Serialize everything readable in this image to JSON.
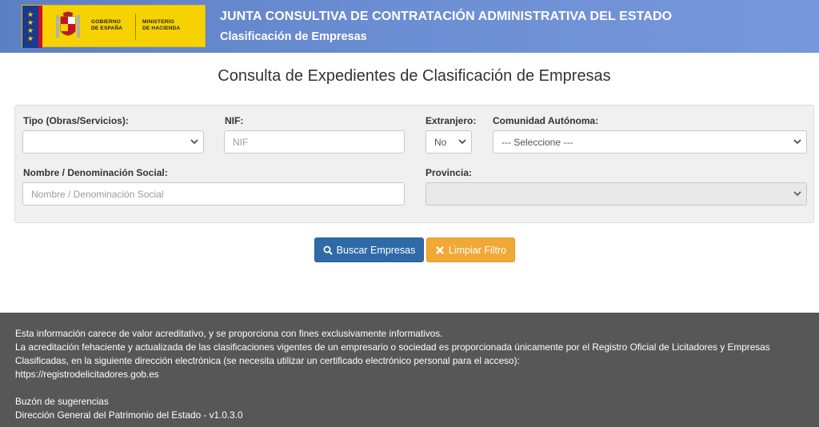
{
  "header": {
    "logo": {
      "gobierno_line1": "GOBIERNO",
      "gobierno_line2": "DE ESPAÑA",
      "ministerio_line1": "MINISTERIO",
      "ministerio_line2": "DE HACIENDA"
    },
    "title": "JUNTA CONSULTIVA DE CONTRATACIÓN ADMINISTRATIVA DEL ESTADO",
    "subtitle": "Clasificación de Empresas"
  },
  "page_title": "Consulta de Expedientes de Clasificación de Empresas",
  "form": {
    "tipo": {
      "label": "Tipo (Obras/Servicios):",
      "value": ""
    },
    "nif": {
      "label": "NIF:",
      "placeholder": "NIF"
    },
    "extranjero": {
      "label": "Extranjero:",
      "value": "No"
    },
    "comunidad": {
      "label": "Comunidad Autónoma:",
      "value": "--- Seleccione ---"
    },
    "nombre": {
      "label": "Nombre / Denominación Social:",
      "placeholder": "Nombre / Denominación Social"
    },
    "provincia": {
      "label": "Provincia:",
      "value": ""
    }
  },
  "buttons": {
    "search": "Buscar Empresas",
    "clear": "Limpiar Filtro"
  },
  "footer": {
    "line1": "Esta información carece de valor acreditativo, y se proporciona con fines exclusivamente informativos.",
    "line2": "La acreditación fehaciente y actualizada de las clasificaciones vigentes de un empresario o sociedad es proporcionada únicamente por el Registro Oficial de Licitadores y Empresas",
    "line3": "Clasificadas, en la siguiente dirección electrónica (se necesita utilizar un certificado electrónico personal para el acceso):",
    "link": "https://registrodelicitadores.gob.es",
    "suggestions": "Buzón de sugerencias",
    "version": "Dirección General del Patrimonio del Estado - v1.0.3.0"
  },
  "colors": {
    "header_bg": "#6c8ed3",
    "primary": "#2f6aa7",
    "warning": "#f0a936",
    "footer_bg": "#575757",
    "logo_bg": "#f6d300"
  },
  "icons": {
    "search_button_icon": "search-icon",
    "clear_button_icon": "close-icon",
    "select_icon": "chevron-down-icon",
    "coat_of_arms": "coat-of-arms-icon"
  }
}
